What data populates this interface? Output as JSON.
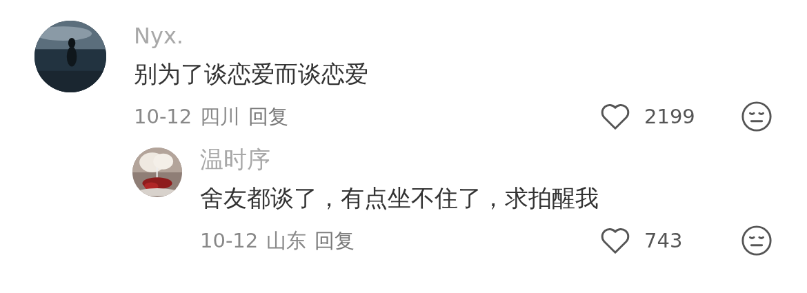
{
  "comments": [
    {
      "author": "Nyx.",
      "text": "别为了谈恋爱而谈恋爱",
      "date": "10-12",
      "location": "四川",
      "reply": "回复",
      "likes": "2199",
      "replies": [
        {
          "author": "温时序",
          "text": "舍友都谈了，有点坐不住了，求拍醒我",
          "date": "10-12",
          "location": "山东",
          "reply": "回复",
          "likes": "743"
        }
      ]
    }
  ]
}
